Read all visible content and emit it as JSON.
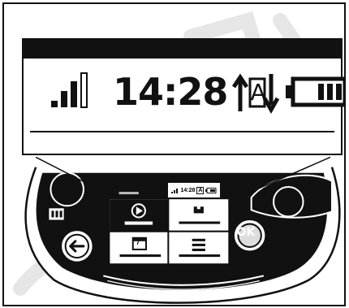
{
  "status_bar": {
    "time": "14:28",
    "signal_level": 0.75,
    "battery_level": 0.6,
    "mode_letter": "A"
  },
  "mini_status": {
    "time": "14:28",
    "mode_letter": "A"
  },
  "device": {
    "ok_label": "OK",
    "calendar_day": "7"
  },
  "colors": {
    "ink": "#111111",
    "watermark": "#e8e8e8",
    "body": "#ffffff"
  },
  "icons": [
    "signal-icon",
    "auto-mode-icon",
    "battery-icon",
    "play-icon",
    "lamp-icon",
    "calendar-icon",
    "menu-icon",
    "back-icon",
    "ok-icon",
    "coffee-icon",
    "bean-icon",
    "dial-icon"
  ]
}
